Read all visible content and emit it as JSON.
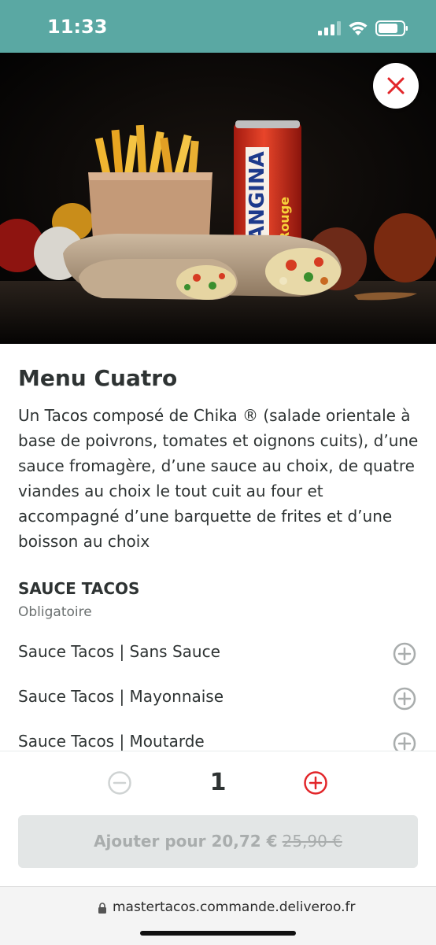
{
  "status_bar": {
    "time": "11:33"
  },
  "hero": {
    "image_description_icon": "food-photo"
  },
  "product": {
    "title": "Menu Cuatro",
    "description": "Un Tacos composé de Chika ® (salade orientale à base de poivrons, tomates et oignons cuits), d’une sauce fromagère, d’une sauce au choix, de quatre viandes au choix le tout cuit au four et accompagné d’une barquette de frites et d’une boisson au choix"
  },
  "section": {
    "title": "SAUCE TACOS",
    "subtitle": "Obligatoire",
    "options": [
      {
        "label": "Sauce Tacos | Sans Sauce"
      },
      {
        "label": "Sauce Tacos | Mayonnaise"
      },
      {
        "label": "Sauce Tacos | Moutarde"
      }
    ]
  },
  "footer": {
    "quantity": "1",
    "add_label": "Ajouter pour 20,72 €",
    "old_price": "25,90 €"
  },
  "browser": {
    "url": "mastertacos.commande.deliveroo.fr"
  },
  "colors": {
    "accent": "#e2262a",
    "status_bar": "#5aa8a3",
    "disabled": "#a9adad"
  }
}
